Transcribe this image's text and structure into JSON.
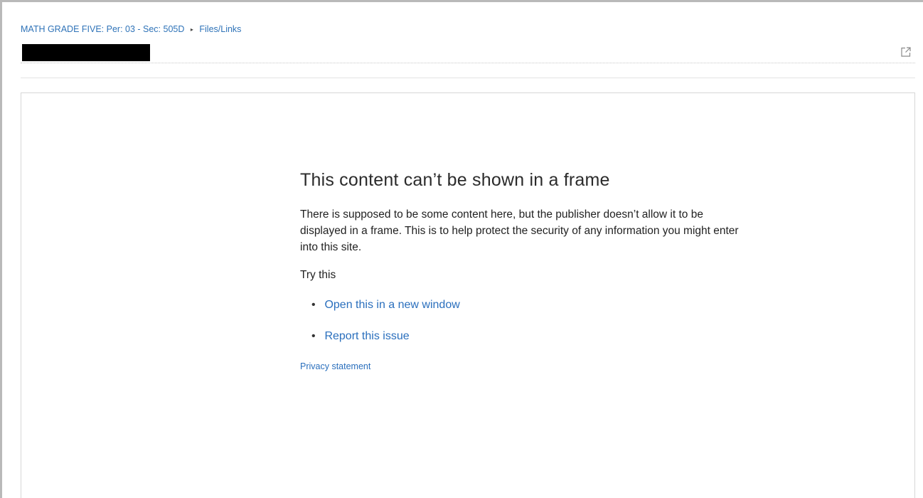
{
  "breadcrumb": {
    "course": "MATH GRADE FIVE: Per: 03 - Sec: 505D",
    "separator": "▸",
    "section": "Files/Links"
  },
  "title_row": {
    "redacted_title": "",
    "popout_icon": "external-link-icon"
  },
  "frame_error": {
    "heading": "This content can’t be shown in a frame",
    "description": "There is supposed to be some content here, but the publisher doesn’t allow it to be displayed in a frame. This is to help protect the security of any information you might enter into this site.",
    "try_label": "Try this",
    "options": [
      {
        "label": "Open this in a new window"
      },
      {
        "label": "Report this issue"
      }
    ],
    "privacy_link": "Privacy statement"
  },
  "colors": {
    "link": "#2a6fbd",
    "border": "#b9b9b9",
    "redaction": "#000000"
  }
}
